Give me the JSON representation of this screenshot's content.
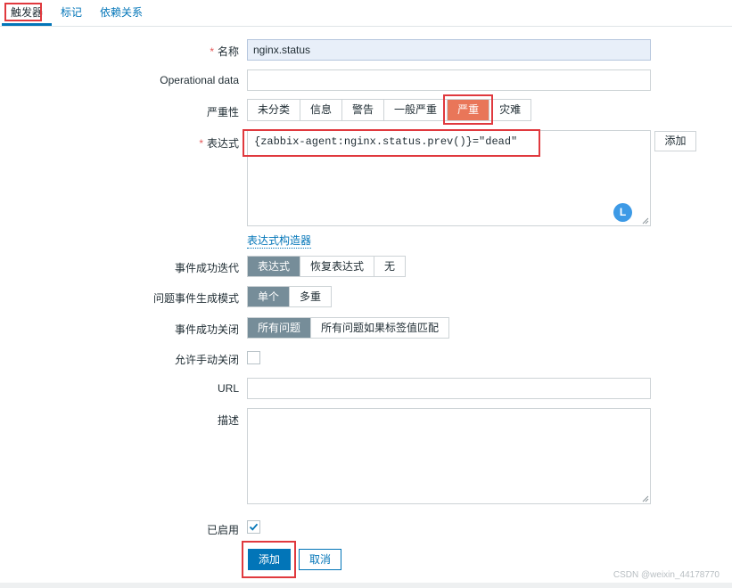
{
  "tabs": [
    "触发器",
    "标记",
    "依赖关系"
  ],
  "fields": {
    "name": {
      "label": "名称",
      "value": "nginx.status"
    },
    "opdata": {
      "label": "Operational data",
      "value": ""
    },
    "severity": {
      "label": "严重性",
      "options": [
        "未分类",
        "信息",
        "警告",
        "一般严重",
        "严重",
        "灾难"
      ],
      "selected": "严重"
    },
    "expression": {
      "label": "表达式",
      "value": "{zabbix-agent:nginx.status.prev()}=\"dead\"",
      "add_button": "添加",
      "builder_link": "表达式构造器",
      "badge": "L"
    },
    "ok_event": {
      "label": "事件成功迭代",
      "options": [
        "表达式",
        "恢复表达式",
        "无"
      ],
      "selected": "表达式"
    },
    "problem_mode": {
      "label": "问题事件生成模式",
      "options": [
        "单个",
        "多重"
      ],
      "selected": "单个"
    },
    "ok_close": {
      "label": "事件成功关闭",
      "options": [
        "所有问题",
        "所有问题如果标签值匹配"
      ],
      "selected": "所有问题"
    },
    "manual_close": {
      "label": "允许手动关闭",
      "checked": false
    },
    "url": {
      "label": "URL",
      "value": ""
    },
    "description": {
      "label": "描述",
      "value": ""
    },
    "enabled": {
      "label": "已启用",
      "checked": true
    }
  },
  "actions": {
    "add": "添加",
    "cancel": "取消"
  },
  "watermark": "CSDN @weixin_44178770",
  "colors": {
    "accent": "#0275b8",
    "severity_high": "#e97659",
    "selected_toggle": "#768d99",
    "highlight_box": "#e0393e"
  }
}
